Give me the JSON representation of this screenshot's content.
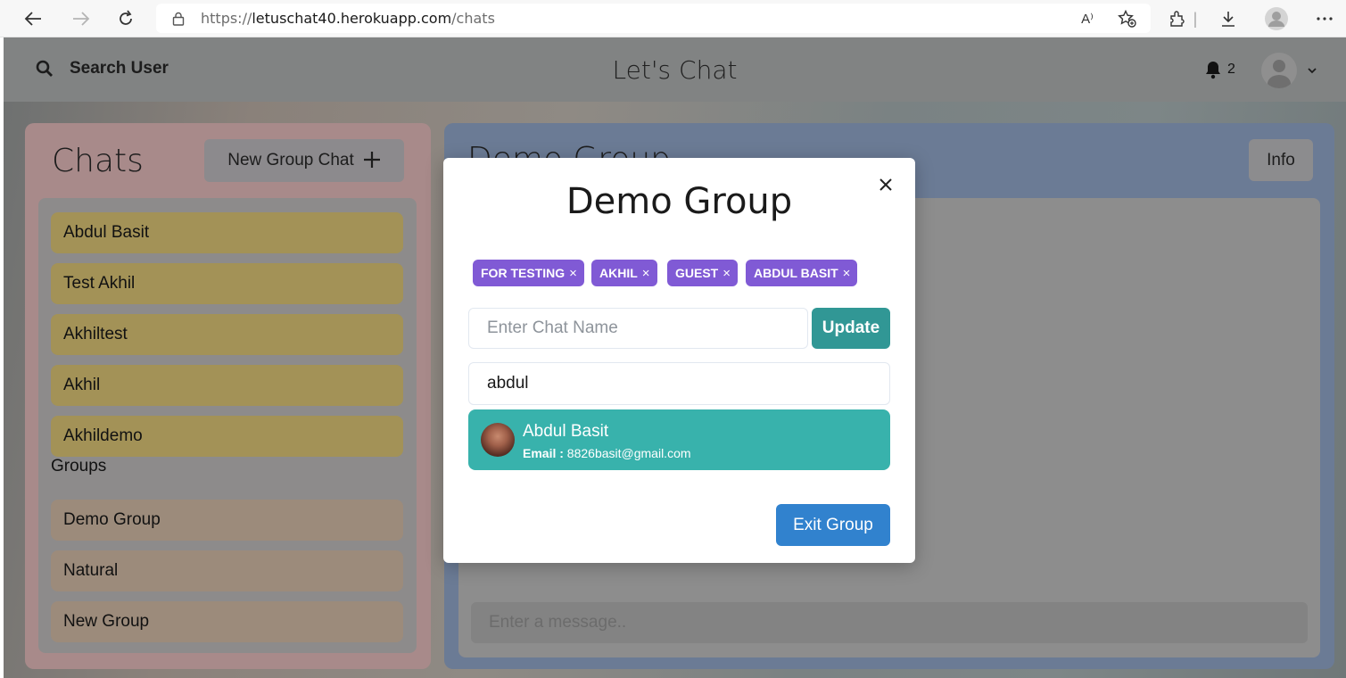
{
  "browser": {
    "url_prefix": "https://",
    "url_domain": "letuschat40.herokuapp.com",
    "url_path": "/chats",
    "read_aloud_label": "A⁾"
  },
  "header": {
    "search_label": "Search User",
    "app_title": "Let's Chat",
    "notification_count": "2"
  },
  "sidebar": {
    "title": "Chats",
    "new_group_label": "New Group Chat",
    "users": [
      "Abdul Basit",
      "Test Akhil",
      "Akhiltest",
      "Akhil",
      "Akhildemo"
    ],
    "groups_label": "Groups",
    "groups": [
      "Demo Group",
      "Natural",
      "New Group"
    ]
  },
  "chat_panel": {
    "title": "Demo Group",
    "info_label": "Info",
    "message_placeholder": "Enter a message.."
  },
  "modal": {
    "title": "Demo Group",
    "members": [
      "FOR TESTING",
      "AKHIL",
      "GUEST",
      "ABDUL BASIT"
    ],
    "chat_name_placeholder": "Enter Chat Name",
    "update_label": "Update",
    "search_value": "abdul",
    "result": {
      "name": "Abdul Basit",
      "email_label": "Email :",
      "email": "8826basit@gmail.com"
    },
    "exit_label": "Exit Group"
  },
  "colors": {
    "badge": "#805ad5",
    "update_button": "#319795",
    "result_item": "#38b2ac",
    "exit_button": "#3182ce"
  }
}
